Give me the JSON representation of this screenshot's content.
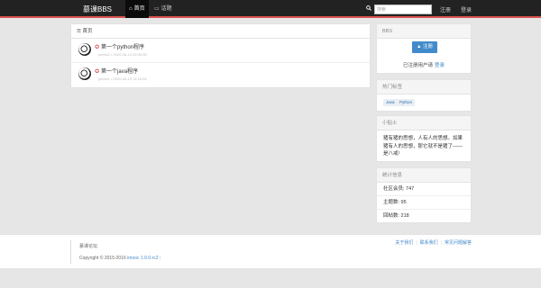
{
  "navbar": {
    "brand": "慕课BBS",
    "tabs": [
      {
        "label": "首页",
        "icon": "home-icon",
        "active": true
      },
      {
        "label": "话题",
        "icon": "comments-icon",
        "active": false
      }
    ],
    "search_placeholder": "搜索",
    "register": "注册",
    "login": "登录"
  },
  "main": {
    "heading": "首页",
    "topics": [
      {
        "title": "第一个python程序",
        "meta": "jomes2 • 2020-06-13 22:30:55",
        "icon": "pin-icon"
      },
      {
        "title": "第一个java程序",
        "meta": "jomes1 • 2020-06-13 14:16:54",
        "icon": "pin-icon"
      }
    ]
  },
  "sidebar": {
    "bbs": {
      "heading": "BBS",
      "button": "注册",
      "registered_text": "已注册用户请",
      "login_link": "登录"
    },
    "tags": {
      "heading": "热门标签",
      "items": [
        "Java",
        "Python"
      ]
    },
    "tips": {
      "heading": "小贴士",
      "body": "猪有猪的思想，人有人的思想。如果猪有人的思想，那它就不是猪了——是八戒!"
    },
    "stats": {
      "heading": "统计信息",
      "rows": [
        "社区会员: 747",
        "主题数: 95",
        "回帖数: 218"
      ]
    }
  },
  "footer": {
    "name": "慕课论坛",
    "copyright": "Copyright © 2015-2016",
    "version": "imooc 1.0.0-rc2",
    "links": [
      "关于我们",
      "联系我们",
      "常见问题解答"
    ]
  },
  "colors": {
    "accent": "#428bca",
    "navbar": "#222222",
    "navbar_border": "#d9534f"
  }
}
